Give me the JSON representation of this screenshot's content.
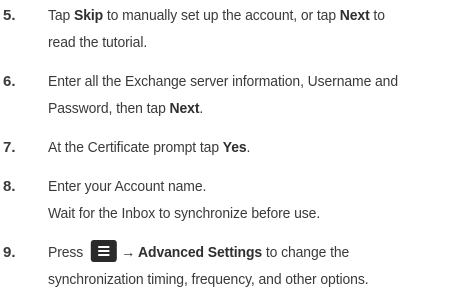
{
  "steps": [
    {
      "num": "5.",
      "l1a": "Tap ",
      "l1b": "Skip",
      "l1c": " to manually set up the account, or tap ",
      "l1d": "Next",
      "l1e": " to",
      "l2": "read the tutorial."
    },
    {
      "num": "6.",
      "l1": "Enter all the Exchange server information, Username and",
      "l2a": "Password, then tap ",
      "l2b": "Next",
      "l2c": "."
    },
    {
      "num": "7.",
      "l1a": "At the Certificate prompt tap ",
      "l1b": "Yes",
      "l1c": "."
    },
    {
      "num": "8.",
      "l1": "Enter your Account name.",
      "l2": "Wait for the Inbox to synchronize before use."
    },
    {
      "num": "9.",
      "l1a": "Press ",
      "icon": "menu-key-icon",
      "arrow": "→",
      "l1b": "Advanced Settings",
      "l1c": " to change the",
      "l2": "synchronization timing, frequency, and other options."
    }
  ]
}
